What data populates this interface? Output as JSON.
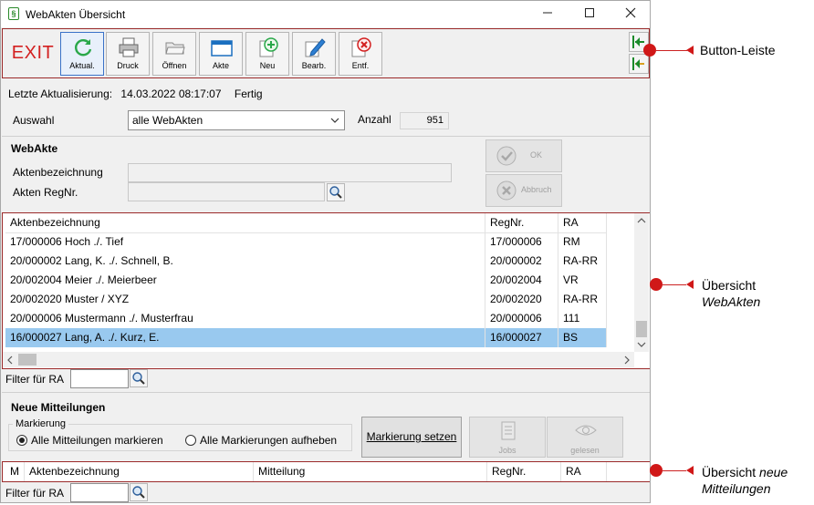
{
  "window": {
    "title": "WebAkten Übersicht",
    "app_icon": "§"
  },
  "toolbar": {
    "exit_label": "EXIT",
    "buttons": [
      {
        "label": "Aktual.",
        "icon": "refresh-icon"
      },
      {
        "label": "Druck",
        "icon": "printer-icon"
      },
      {
        "label": "Öffnen",
        "icon": "open-folder-icon"
      },
      {
        "label": "Akte",
        "icon": "folder-icon"
      },
      {
        "label": "Neu",
        "icon": "add-icon"
      },
      {
        "label": "Bearb.",
        "icon": "edit-icon"
      },
      {
        "label": "Entf.",
        "icon": "delete-icon"
      }
    ]
  },
  "status": {
    "label": "Letzte Aktualisierung:",
    "datetime": "14.03.2022 08:17:07",
    "state": "Fertig"
  },
  "filter": {
    "auswahl_label": "Auswahl",
    "auswahl_value": "alle WebAkten",
    "anzahl_label": "Anzahl",
    "anzahl_value": "951"
  },
  "webakte": {
    "heading": "WebAkte",
    "field1_label": "Aktenbezeichnung",
    "field2_label": "Akten RegNr.",
    "ok_label": "OK",
    "cancel_label": "Abbruch"
  },
  "akten_table": {
    "columns": [
      "Aktenbezeichnung",
      "RegNr.",
      "RA"
    ],
    "rows": [
      {
        "bez": "17/000006 Hoch ./. Tief",
        "reg": "17/000006",
        "ra": "RM"
      },
      {
        "bez": "20/000002 Lang, K. ./. Schnell, B.",
        "reg": "20/000002",
        "ra": "RA-RR"
      },
      {
        "bez": "20/002004 Meier ./. Meierbeer",
        "reg": "20/002004",
        "ra": "VR"
      },
      {
        "bez": "20/002020 Muster / XYZ",
        "reg": "20/002020",
        "ra": "RA-RR"
      },
      {
        "bez": "20/000006 Mustermann ./. Musterfrau",
        "reg": "20/000006",
        "ra": "111"
      },
      {
        "bez": "16/000027 Lang, A. ./. Kurz, E.",
        "reg": "16/000027",
        "ra": "BS"
      }
    ]
  },
  "filter_ra_label": "Filter für RA",
  "mitteilungen": {
    "heading": "Neue Mitteilungen",
    "group_label": "Markierung",
    "radio1": "Alle Mitteilungen markieren",
    "radio2": "Alle Markierungen aufheben",
    "mark_button": "Markierung setzen",
    "jobs_label": "Jobs",
    "read_label": "gelesen"
  },
  "mitteilungen_table": {
    "columns": [
      "M",
      "Aktenbezeichnung",
      "Mitteilung",
      "RegNr.",
      "RA"
    ]
  },
  "callouts": {
    "toolbar": "Button-Leiste",
    "akten_line1": "Übersicht",
    "akten_line2": "WebAkten",
    "mitt_line1": "Übersicht",
    "mitt_line1b": "neue",
    "mitt_line2": "Mitteilungen"
  },
  "colors": {
    "selection": "#99c9ef",
    "callout": "#d01818",
    "exit": "#d32020"
  }
}
